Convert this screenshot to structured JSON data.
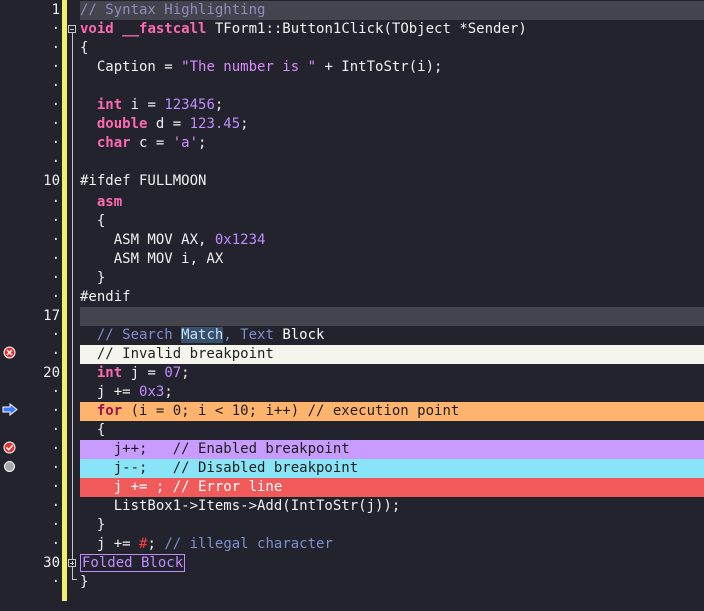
{
  "editor": {
    "line_numbers": {
      "l1": "1",
      "l10": "10",
      "l17": "17",
      "l20": "20",
      "l30": "30"
    },
    "dot": "·",
    "lines": {
      "comment_header": "// Syntax Highlighting",
      "func_kw_void": "void",
      "func_kw_fastcall": "__fastcall",
      "func_rest": " TForm1::Button1Click(TObject *Sender)",
      "open_brace": "{",
      "caption_pre": "  Caption = ",
      "caption_str": "\"The number is \"",
      "caption_post": " + IntToStr(i);",
      "int_kw": "int",
      "int_mid": " i = ",
      "int_val": "123456",
      "double_kw": "double",
      "double_mid": " d = ",
      "double_val": "123.45",
      "char_kw": "char",
      "char_mid": " c = ",
      "char_val": "'a'",
      "ifdef_pre": "#ifdef FULLMOON",
      "asm_kw": "asm",
      "asm_open": "  {",
      "asm1_pre": "    ASM MOV AX, ",
      "asm1_val": "0x1234",
      "asm2": "    ASM MOV i, AX",
      "asm_close": "  }",
      "endif": "#endif",
      "search_cmt_a": "// Search ",
      "search_match": "Match",
      "search_cmt_b": ", Text ",
      "search_block": "Block",
      "invalid_bp": "  // Invalid breakpoint",
      "j_kw": "int",
      "j_mid": " j = ",
      "j_val": "07",
      "j_end": ";",
      "jplus_pre": "  j += ",
      "jplus_val": "0x3",
      "jplus_end": ";",
      "for_kw": "for",
      "for_rest": " (i = 0; i < 10; i++) // execution point",
      "inner_open": "  {",
      "enabled_bp": "    j++;   // Enabled breakpoint",
      "disabled_bp": "    j--;   // Disabled breakpoint",
      "error_line": "    j += ; // Error line",
      "listbox": "    ListBox1->Items->Add(IntToStr(j));",
      "inner_close": "  }",
      "illegal_pre": "  j += ",
      "illegal_char": "#",
      "illegal_semi": "; ",
      "illegal_cmt": "// illegal character",
      "folded": "Folded Block",
      "close_brace": "}"
    }
  },
  "gutter_icons": {
    "invalid": "invalid-breakpoint-icon",
    "exec": "execution-point-arrow-icon",
    "enabled": "enabled-breakpoint-icon",
    "disabled": "disabled-breakpoint-icon"
  },
  "colors": {
    "background": "#23232e",
    "gutter_bar": "#f0f06e",
    "keyword": "#ff69b4",
    "number": "#c08cff",
    "comment": "#b0a0e0",
    "current_line": "#44444f",
    "invalid_breakpoint_bg": "#f5f5ee",
    "execution_point_bg": "#ffb46e",
    "enabled_breakpoint_bg": "#c89cff",
    "disabled_breakpoint_bg": "#8ae4f8",
    "error_line_bg": "#f05a5a"
  }
}
